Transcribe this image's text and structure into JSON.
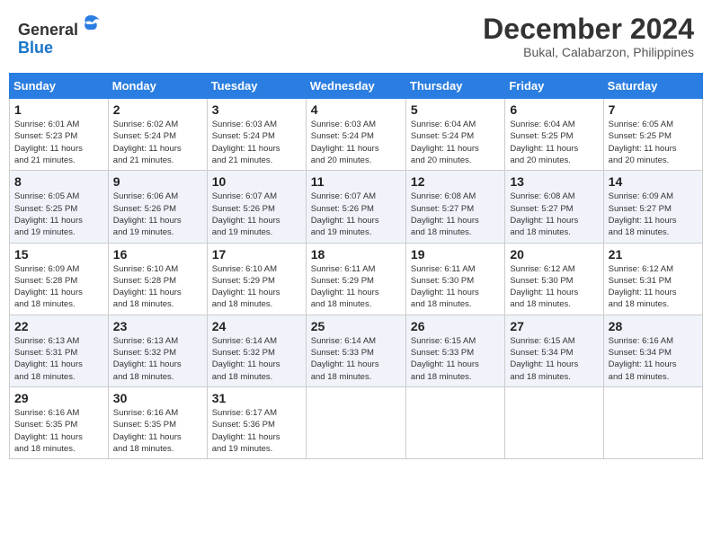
{
  "header": {
    "logo_line1": "General",
    "logo_line2": "Blue",
    "month_title": "December 2024",
    "subtitle": "Bukal, Calabarzon, Philippines"
  },
  "calendar": {
    "weekdays": [
      "Sunday",
      "Monday",
      "Tuesday",
      "Wednesday",
      "Thursday",
      "Friday",
      "Saturday"
    ],
    "weeks": [
      [
        {
          "day": "1",
          "info": "Sunrise: 6:01 AM\nSunset: 5:23 PM\nDaylight: 11 hours\nand 21 minutes."
        },
        {
          "day": "2",
          "info": "Sunrise: 6:02 AM\nSunset: 5:24 PM\nDaylight: 11 hours\nand 21 minutes."
        },
        {
          "day": "3",
          "info": "Sunrise: 6:03 AM\nSunset: 5:24 PM\nDaylight: 11 hours\nand 21 minutes."
        },
        {
          "day": "4",
          "info": "Sunrise: 6:03 AM\nSunset: 5:24 PM\nDaylight: 11 hours\nand 20 minutes."
        },
        {
          "day": "5",
          "info": "Sunrise: 6:04 AM\nSunset: 5:24 PM\nDaylight: 11 hours\nand 20 minutes."
        },
        {
          "day": "6",
          "info": "Sunrise: 6:04 AM\nSunset: 5:25 PM\nDaylight: 11 hours\nand 20 minutes."
        },
        {
          "day": "7",
          "info": "Sunrise: 6:05 AM\nSunset: 5:25 PM\nDaylight: 11 hours\nand 20 minutes."
        }
      ],
      [
        {
          "day": "8",
          "info": "Sunrise: 6:05 AM\nSunset: 5:25 PM\nDaylight: 11 hours\nand 19 minutes."
        },
        {
          "day": "9",
          "info": "Sunrise: 6:06 AM\nSunset: 5:26 PM\nDaylight: 11 hours\nand 19 minutes."
        },
        {
          "day": "10",
          "info": "Sunrise: 6:07 AM\nSunset: 5:26 PM\nDaylight: 11 hours\nand 19 minutes."
        },
        {
          "day": "11",
          "info": "Sunrise: 6:07 AM\nSunset: 5:26 PM\nDaylight: 11 hours\nand 19 minutes."
        },
        {
          "day": "12",
          "info": "Sunrise: 6:08 AM\nSunset: 5:27 PM\nDaylight: 11 hours\nand 18 minutes."
        },
        {
          "day": "13",
          "info": "Sunrise: 6:08 AM\nSunset: 5:27 PM\nDaylight: 11 hours\nand 18 minutes."
        },
        {
          "day": "14",
          "info": "Sunrise: 6:09 AM\nSunset: 5:27 PM\nDaylight: 11 hours\nand 18 minutes."
        }
      ],
      [
        {
          "day": "15",
          "info": "Sunrise: 6:09 AM\nSunset: 5:28 PM\nDaylight: 11 hours\nand 18 minutes."
        },
        {
          "day": "16",
          "info": "Sunrise: 6:10 AM\nSunset: 5:28 PM\nDaylight: 11 hours\nand 18 minutes."
        },
        {
          "day": "17",
          "info": "Sunrise: 6:10 AM\nSunset: 5:29 PM\nDaylight: 11 hours\nand 18 minutes."
        },
        {
          "day": "18",
          "info": "Sunrise: 6:11 AM\nSunset: 5:29 PM\nDaylight: 11 hours\nand 18 minutes."
        },
        {
          "day": "19",
          "info": "Sunrise: 6:11 AM\nSunset: 5:30 PM\nDaylight: 11 hours\nand 18 minutes."
        },
        {
          "day": "20",
          "info": "Sunrise: 6:12 AM\nSunset: 5:30 PM\nDaylight: 11 hours\nand 18 minutes."
        },
        {
          "day": "21",
          "info": "Sunrise: 6:12 AM\nSunset: 5:31 PM\nDaylight: 11 hours\nand 18 minutes."
        }
      ],
      [
        {
          "day": "22",
          "info": "Sunrise: 6:13 AM\nSunset: 5:31 PM\nDaylight: 11 hours\nand 18 minutes."
        },
        {
          "day": "23",
          "info": "Sunrise: 6:13 AM\nSunset: 5:32 PM\nDaylight: 11 hours\nand 18 minutes."
        },
        {
          "day": "24",
          "info": "Sunrise: 6:14 AM\nSunset: 5:32 PM\nDaylight: 11 hours\nand 18 minutes."
        },
        {
          "day": "25",
          "info": "Sunrise: 6:14 AM\nSunset: 5:33 PM\nDaylight: 11 hours\nand 18 minutes."
        },
        {
          "day": "26",
          "info": "Sunrise: 6:15 AM\nSunset: 5:33 PM\nDaylight: 11 hours\nand 18 minutes."
        },
        {
          "day": "27",
          "info": "Sunrise: 6:15 AM\nSunset: 5:34 PM\nDaylight: 11 hours\nand 18 minutes."
        },
        {
          "day": "28",
          "info": "Sunrise: 6:16 AM\nSunset: 5:34 PM\nDaylight: 11 hours\nand 18 minutes."
        }
      ],
      [
        {
          "day": "29",
          "info": "Sunrise: 6:16 AM\nSunset: 5:35 PM\nDaylight: 11 hours\nand 18 minutes."
        },
        {
          "day": "30",
          "info": "Sunrise: 6:16 AM\nSunset: 5:35 PM\nDaylight: 11 hours\nand 18 minutes."
        },
        {
          "day": "31",
          "info": "Sunrise: 6:17 AM\nSunset: 5:36 PM\nDaylight: 11 hours\nand 19 minutes."
        },
        {
          "day": "",
          "info": ""
        },
        {
          "day": "",
          "info": ""
        },
        {
          "day": "",
          "info": ""
        },
        {
          "day": "",
          "info": ""
        }
      ]
    ]
  }
}
